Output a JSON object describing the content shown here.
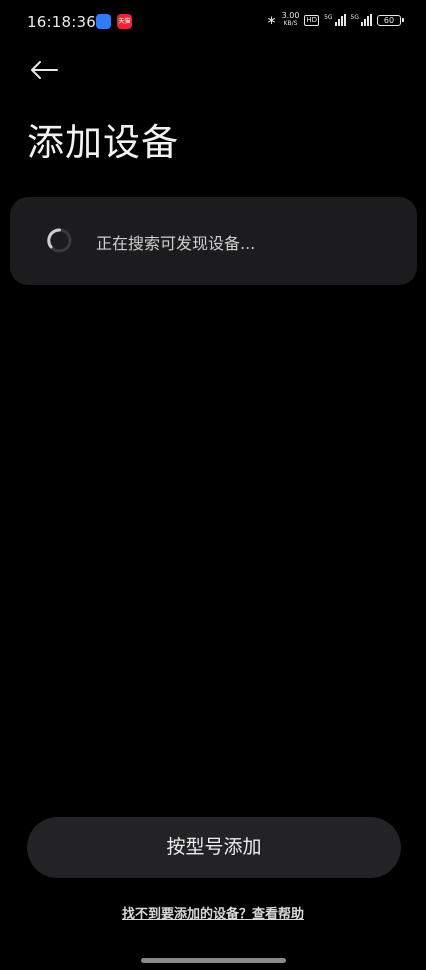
{
  "status_bar": {
    "time": "16:18:36",
    "app_badge_text": "天猫",
    "network_speed_value": "3.00",
    "network_speed_unit": "KB/S",
    "hd_label": "HD",
    "signal1_label": "5G",
    "signal2_label": "5G",
    "battery_level": "60"
  },
  "header": {
    "title": "添加设备"
  },
  "search_card": {
    "status_text": "正在搜索可发现设备..."
  },
  "actions": {
    "add_by_model_label": "按型号添加",
    "help_link_text": "找不到要添加的设备？查看帮助"
  },
  "colors": {
    "background": "#000000",
    "card": "#1c1c1e",
    "button": "#232325"
  }
}
